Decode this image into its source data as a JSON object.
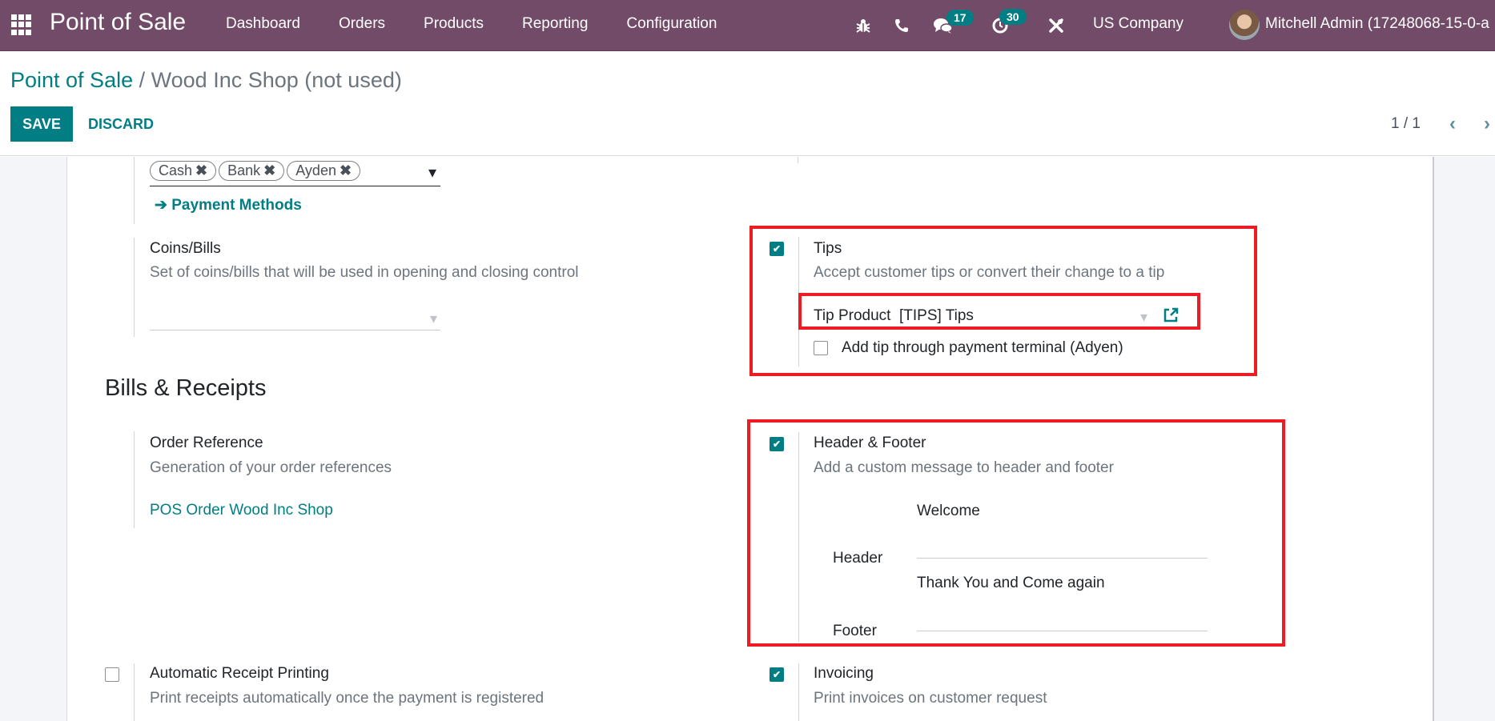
{
  "topbar": {
    "app_name": "Point of Sale",
    "menu": [
      "Dashboard",
      "Orders",
      "Products",
      "Reporting",
      "Configuration"
    ],
    "messages_count": "17",
    "activities_count": "30",
    "company": "US Company",
    "user": "Mitchell Admin (17248068-15-0-a"
  },
  "control": {
    "breadcrumb_root": "Point of Sale",
    "breadcrumb_sep": "/",
    "breadcrumb_current": "Wood Inc Shop (not used)",
    "save_label": "SAVE",
    "discard_label": "DISCARD",
    "pager": "1 / 1",
    "prev_icon": "‹",
    "next_icon": "›"
  },
  "payments": {
    "tags": [
      "Cash",
      "Bank",
      "Ayden"
    ],
    "tag_remove": "✖",
    "dropdown_icon": "▾",
    "link": "Payment Methods",
    "link_arrow": "➔"
  },
  "coins_bills": {
    "title": "Coins/Bills",
    "description": "Set of coins/bills that will be used in opening and closing control",
    "value": ""
  },
  "tips": {
    "checked": true,
    "title": "Tips",
    "description": "Accept customer tips or convert their change to a tip",
    "product_label": "Tip Product",
    "product_value": "[TIPS] Tips",
    "terminal_checked": false,
    "terminal_label": "Add tip through payment terminal (Adyen)"
  },
  "bills_receipts": {
    "section_title": "Bills & Receipts",
    "order_reference": {
      "title": "Order Reference",
      "description": "Generation of your order references",
      "value": "POS Order Wood Inc Shop"
    },
    "header_footer": {
      "checked": true,
      "title": "Header & Footer",
      "description": "Add a custom message to header and footer",
      "header_label": "Header",
      "header_value": "Welcome",
      "footer_label": "Footer",
      "footer_value": "Thank You and Come again"
    },
    "auto_receipt": {
      "checked": false,
      "title": "Automatic Receipt Printing",
      "description": "Print receipts automatically once the payment is registered"
    },
    "invoicing": {
      "checked": true,
      "title": "Invoicing",
      "description": "Print invoices on customer request"
    }
  },
  "colors": {
    "brand": "#714b67",
    "accent": "#017e84",
    "highlight": "#ed1c24"
  }
}
